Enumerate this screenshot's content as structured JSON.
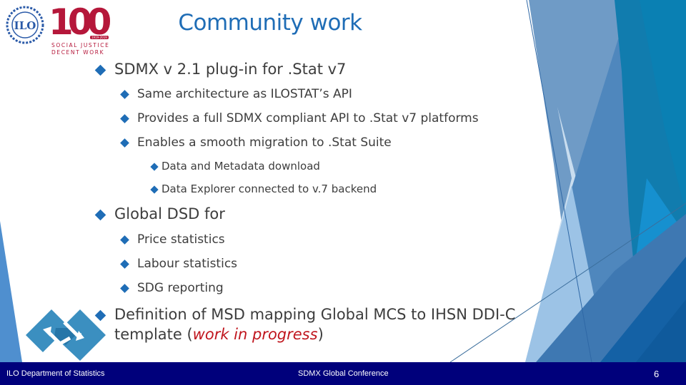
{
  "slide": {
    "title": "Community work",
    "logos": {
      "ilo_emblem": "ILO",
      "centenary_number": "100",
      "centenary_years": "1919-2019",
      "centenary_tagline_1": "SOCIAL JUSTICE",
      "centenary_tagline_2": "DECENT WORK"
    },
    "bullets": [
      {
        "text": "SDMX v 2.1 plug-in for .Stat v7",
        "children": [
          {
            "text": "Same architecture as ILOSTAT’s API"
          },
          {
            "text": "Provides a full SDMX compliant API to .Stat v7 platforms"
          },
          {
            "text": "Enables a smooth migration to .Stat Suite",
            "children": [
              {
                "text": "Data and Metadata download"
              },
              {
                "text": "Data Explorer connected to v.7 backend"
              }
            ]
          }
        ]
      },
      {
        "text": "Global DSD for",
        "children": [
          {
            "text": "Price statistics"
          },
          {
            "text": "Labour statistics"
          },
          {
            "text": "SDG reporting"
          }
        ]
      },
      {
        "text_line1": "Definition of MSD mapping Global MCS to IHSN DDI-C",
        "text_line2_prefix": "template (",
        "text_line2_highlight": "work in progress",
        "text_line2_suffix": ")"
      }
    ]
  },
  "footer": {
    "left": "ILO Department of Statistics",
    "center": "SDMX Global Conference",
    "page_number": "6"
  },
  "colors": {
    "title": "#1f6db6",
    "bullet": "#1f6db6",
    "body_text": "#3d3d3d",
    "highlight": "#c0161e",
    "footer_bg": "#00007b",
    "ilo_red": "#b5173a"
  }
}
